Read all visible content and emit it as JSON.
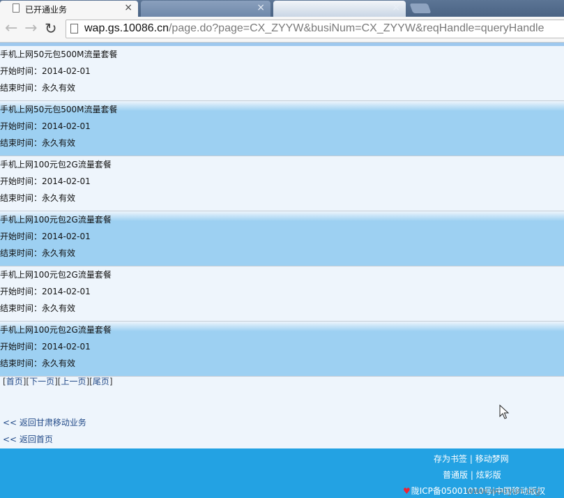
{
  "browser": {
    "tabs": [
      {
        "title": "已开通业务",
        "close": "×"
      },
      {
        "title": "",
        "close": "×"
      },
      {
        "title": "",
        "close": "×"
      }
    ],
    "url_host": "wap.gs.10086.cn",
    "url_path": "/page.do?page=CX_ZYYW&busiNum=CX_ZYYW&reqHandle=queryHandle",
    "back_glyph": "←",
    "forward_glyph": "→",
    "reload_glyph": "↻"
  },
  "records": [
    {
      "name": "手机上网50元包500M流量套餐",
      "start": "开始时间：2014-02-01",
      "end": "结束时间：永久有效"
    },
    {
      "name": "手机上网50元包500M流量套餐",
      "start": "开始时间：2014-02-01",
      "end": "结束时间：永久有效"
    },
    {
      "name": "手机上网100元包2G流量套餐",
      "start": "开始时间：2014-02-01",
      "end": "结束时间：永久有效"
    },
    {
      "name": "手机上网100元包2G流量套餐",
      "start": "开始时间：2014-02-01",
      "end": "结束时间：永久有效"
    },
    {
      "name": "手机上网100元包2G流量套餐",
      "start": "开始时间：2014-02-01",
      "end": "结束时间：永久有效"
    },
    {
      "name": "手机上网100元包2G流量套餐",
      "start": "开始时间：2014-02-01",
      "end": "结束时间：永久有效"
    }
  ],
  "pager": {
    "first": "首页",
    "next": "下一页",
    "prev": "上一页",
    "last": "尾页"
  },
  "links": {
    "back_gansu": "<< 返回甘肃移动业务",
    "back_home": "<< 返回首页"
  },
  "footer": {
    "bookmark": "存为书签",
    "mobile_dream": "移动梦网",
    "basic_version": "普通版",
    "color_version": "炫彩版",
    "icp": "陇ICP备05001010号|中国移动版权",
    "separator": "|"
  },
  "watermark": "www.wooyun.org",
  "colors": {
    "footer_bg": "#23a2e3",
    "row_highlight": "#9dd0f2",
    "page_bg": "#eef5fc"
  }
}
